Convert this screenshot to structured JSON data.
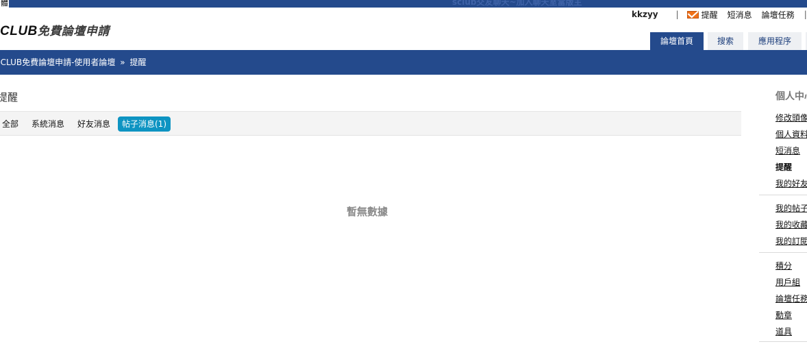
{
  "topbar": {
    "left_text": "體",
    "marquee": "sclub交友聊天~加入聊天室當版主"
  },
  "header": {
    "logo_brand": "CLUB",
    "logo_text": "免費論壇申請",
    "username": "kkzyy",
    "sep": "|",
    "links": {
      "remind": "提醒",
      "pm": "短消息",
      "tasks": "論壇任務"
    }
  },
  "nav_tabs": [
    "論壇首頁",
    "搜索",
    "應用程序"
  ],
  "breadcrumb": {
    "root": "SCLUB免費論壇申請-使用者論壇",
    "arrow": "»",
    "current": "提醒"
  },
  "main": {
    "title": "提醒",
    "filters": [
      "全部",
      "系統消息",
      "好友消息",
      "帖子消息(1)"
    ],
    "empty_text": "暫無數據"
  },
  "sidebar": {
    "title": "個人中心",
    "group1": [
      "修改頭像",
      "個人資料",
      "短消息",
      "提醒",
      "我的好友"
    ],
    "group2": [
      "我的帖子",
      "我的收藏",
      "我的訂閱"
    ],
    "group3": [
      "積分",
      "用戶組",
      "論壇任務",
      "勳章",
      "道具"
    ]
  },
  "colors": {
    "brand_blue": "#244a8c",
    "active_filter": "#0e94c2",
    "mail_icon": "#f07018"
  }
}
